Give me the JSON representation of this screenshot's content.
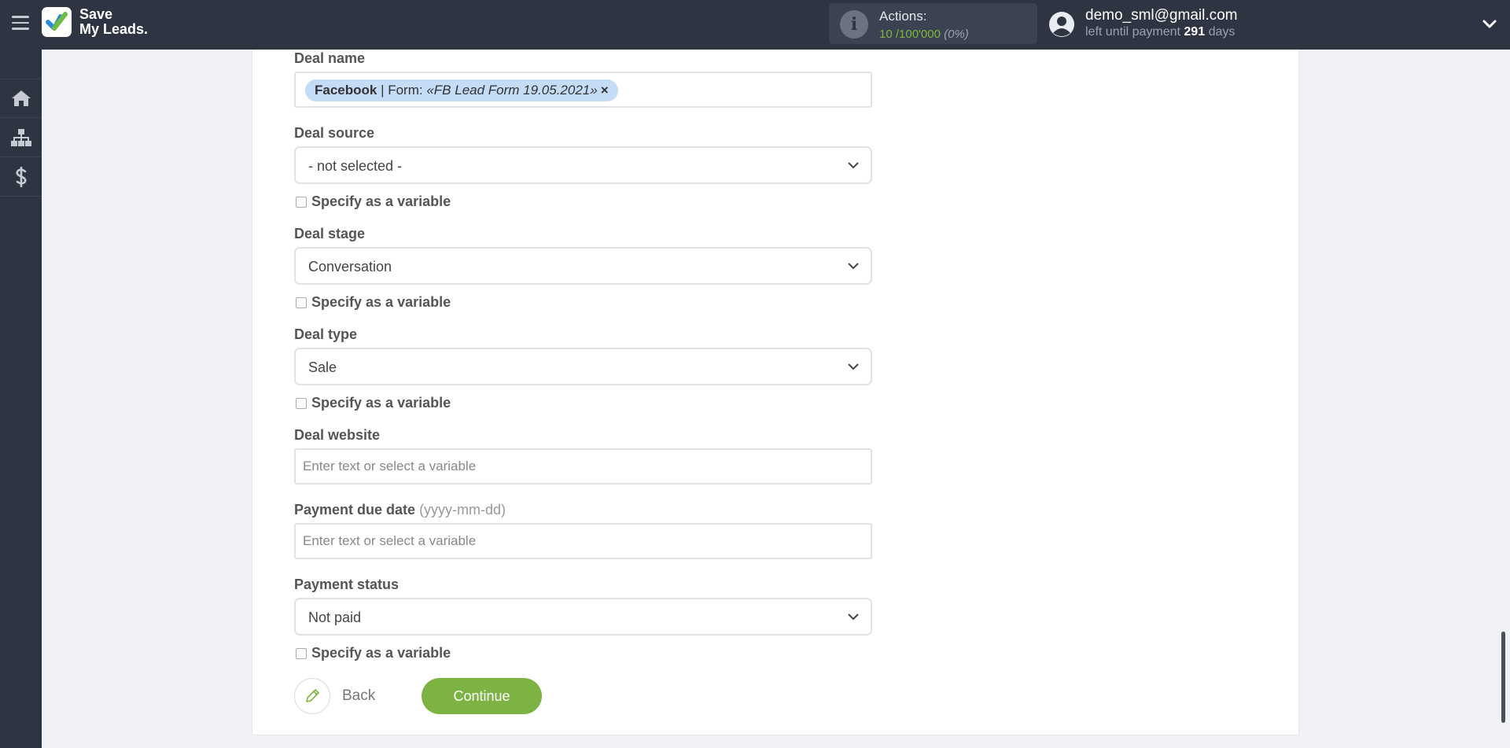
{
  "app": {
    "logo_line1": "Save",
    "logo_line2": "My Leads."
  },
  "header": {
    "actions_label": "Actions:",
    "actions_used": "10",
    "actions_separator": "/",
    "actions_total": "100'000",
    "actions_pct": "(0%)",
    "user_email": "demo_sml@gmail.com",
    "days_prefix": "left until payment",
    "days_count": "291",
    "days_suffix": "days"
  },
  "sidebar": {
    "items": [
      {
        "icon": "home-icon"
      },
      {
        "icon": "sitemap-icon"
      },
      {
        "icon": "dollar-icon"
      }
    ]
  },
  "form": {
    "deal_name": {
      "label": "Deal name",
      "tag_source": "Facebook",
      "tag_sep": " | Form: ",
      "tag_form": "«FB Lead Form 19.05.2021»",
      "tag_remove": "×"
    },
    "deal_source": {
      "label": "Deal source",
      "value": "- not selected -"
    },
    "deal_stage": {
      "label": "Deal stage",
      "value": "Conversation"
    },
    "deal_type": {
      "label": "Deal type",
      "value": "Sale"
    },
    "deal_website": {
      "label": "Deal website",
      "placeholder": "Enter text or select a variable"
    },
    "payment_due_date": {
      "label": "Payment due date",
      "hint": "(yyyy-mm-dd)",
      "placeholder": "Enter text or select a variable"
    },
    "payment_status": {
      "label": "Payment status",
      "value": "Not paid"
    },
    "specify_variable": "Specify as a variable"
  },
  "buttons": {
    "back": "Back",
    "continue": "Continue"
  },
  "colors": {
    "header_bg": "#2e3441",
    "accent_green": "#7cb342",
    "tag_bg": "#c4dcf5"
  }
}
